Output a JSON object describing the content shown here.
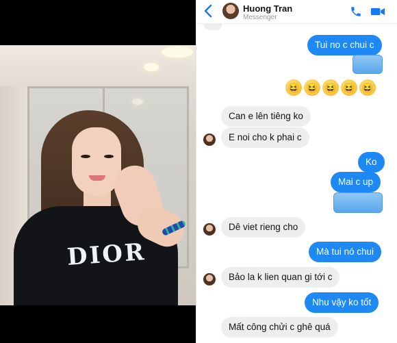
{
  "header": {
    "name": "Huong Tran",
    "subtitle": "Messenger"
  },
  "messages": [
    {
      "side": "out",
      "text": "Tui no c chui c"
    },
    {
      "side": "out",
      "text": "🤣🤣🤣🤣🤣"
    },
    {
      "side": "in",
      "text": "Can e lên tiêng ko"
    },
    {
      "side": "in",
      "text": "E noi cho k phai c"
    },
    {
      "side": "out",
      "text": "Ko"
    },
    {
      "side": "out",
      "text": "Mai c up"
    },
    {
      "side": "in",
      "text": "Dê viet rieng cho"
    },
    {
      "side": "out",
      "text": "Mà tui nó chui"
    },
    {
      "side": "in",
      "text": "Bảo la k lien quan gi tới c"
    },
    {
      "side": "out",
      "text": "Nhu vậy ko tốt"
    },
    {
      "side": "in",
      "text": "Mất công chửi c ghê quá"
    }
  ],
  "photo": {
    "shirt_text": "DIOR"
  },
  "colors": {
    "accent": "#1877f2",
    "outgoing_bubble": "#1e88f5",
    "incoming_bubble": "#eeeeee"
  },
  "icons": [
    "back-arrow-icon",
    "phone-icon",
    "video-camera-icon",
    "laughing-emoji-icon"
  ]
}
